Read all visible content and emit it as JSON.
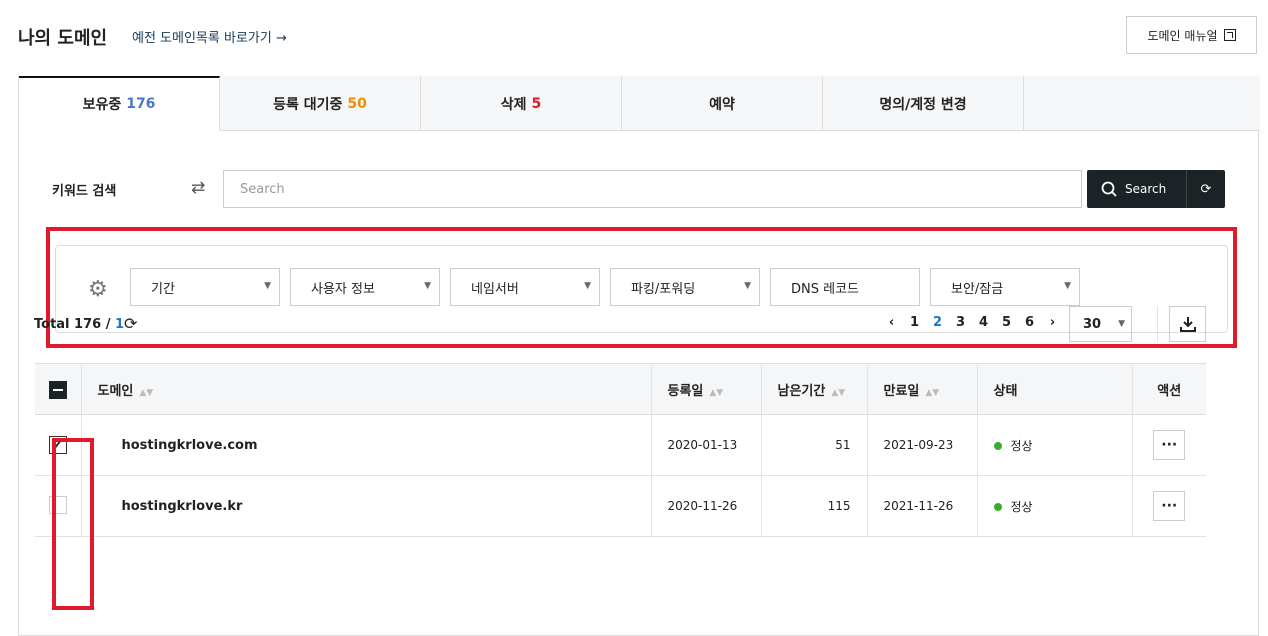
{
  "header": {
    "title": "나의 도메인",
    "old_list_link": "예전 도메인목록 바로가기 →",
    "manual_button": "도메인 매뉴얼"
  },
  "tabs": [
    {
      "label": "보유중",
      "count": "176",
      "count_color": "#1b77c4"
    },
    {
      "label": "등록 대기중",
      "count": "50",
      "count_color": "#f28c00"
    },
    {
      "label": "삭제",
      "count": "5",
      "count_color": "#e0192b"
    },
    {
      "label": "예약",
      "count": ""
    },
    {
      "label": "명의/계정 변경",
      "count": ""
    }
  ],
  "search": {
    "label": "키워드 검색",
    "placeholder": "Search",
    "button": "Search"
  },
  "filters": [
    "기간",
    "사용자 정보",
    "네임서버",
    "파킹/포워딩",
    "DNS 레코드",
    "보안/잠금"
  ],
  "summary": {
    "total_label": "Total 176 / ",
    "page": "1"
  },
  "pagination": {
    "pages": [
      "1",
      "2",
      "3",
      "4",
      "5",
      "6"
    ],
    "current": "2",
    "prev": "‹",
    "next": "›",
    "per_page": "30"
  },
  "table": {
    "headers": {
      "domain": "도메인",
      "registered": "등록일",
      "remaining": "남은기간",
      "expires": "만료일",
      "status": "상태",
      "action": "액션"
    },
    "rows": [
      {
        "domain": "hostingkrlove.com",
        "registered": "2020-01-13",
        "remaining": "51",
        "expires": "2021-09-23",
        "status": "정상",
        "checked": true
      },
      {
        "domain": "hostingkrlove.kr",
        "registered": "2020-11-26",
        "remaining": "115",
        "expires": "2021-11-26",
        "status": "정상",
        "checked": false
      }
    ]
  },
  "colors": {
    "highlight": "#e0192b",
    "status_ok": "#3dab2e",
    "primary_dark": "#1b2327",
    "link_blue": "#1b77c4"
  }
}
